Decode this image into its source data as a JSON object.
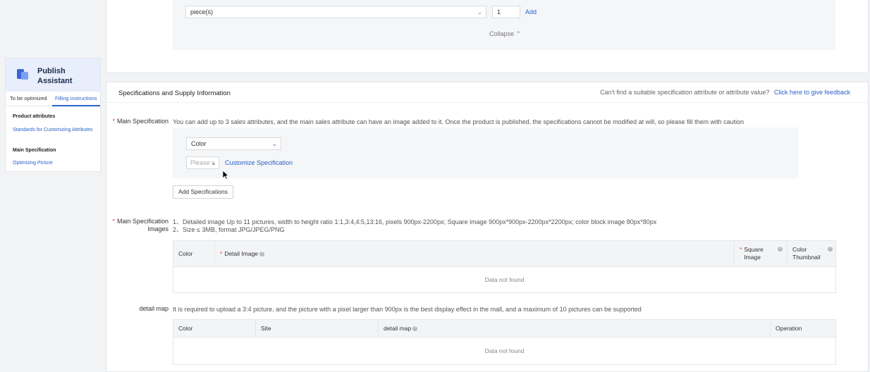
{
  "quantity": {
    "unit": "piece(s)",
    "value": "1",
    "add_label": "Add",
    "collapse_label": "Collapse"
  },
  "assistant": {
    "title": "Publish Assistant",
    "tabs": [
      "To be optimized",
      "Filling instructions"
    ],
    "active_tab": 1,
    "items": [
      {
        "label": "Product attributes",
        "type": "heading"
      },
      {
        "label": "Standards for Customizing Attributes",
        "type": "link"
      },
      {
        "label": "Main Specification",
        "type": "heading"
      },
      {
        "label": "Optimizing Picture",
        "type": "link"
      }
    ]
  },
  "spec": {
    "title": "Specifications and Supply Information",
    "feedback_text": "Can't find a suitable specification attribute or attribute value?",
    "feedback_link": "Click here to give feedback",
    "main_spec": {
      "label": "Main Specification",
      "hint": "You can add up to 3 sales attributes, and the main sales attribute can have an image added to it. Once the product is published, the specifications cannot be modified at will, so please fill them with caution",
      "attribute": "Color",
      "value_placeholder": "Please s",
      "customize_label": "Customize Specification",
      "add_button": "Add Specifications"
    },
    "images": {
      "label": "Main Specification Images",
      "hints": [
        "1、Detailed image Up to 11 pictures, width to height ratio 1:1,3:4,4:5,13:16, pixels 900px-2200px; Square image 900px*900px-2200px*2200px; color block image 80px*80px",
        "2、Size ≤ 3MB, format JPG/JPEG/PNG"
      ],
      "columns": [
        "Color",
        "Detail Image",
        "Square Image",
        "Color Thumbnail"
      ],
      "empty": "Data not found"
    },
    "detail_map": {
      "label": "detail map",
      "hint": "It is required to upload a 3:4 picture, and the picture with a pixel larger than 900px is the best display effect in the mall, and a maximum of 10 pictures can be supported",
      "columns": [
        "Color",
        "Site",
        "detail map",
        "Operation"
      ],
      "empty": "Data not found"
    }
  },
  "colors": {
    "accent": "#2a62c9",
    "required": "#e8453c",
    "assistant_header": "#e8eefb"
  }
}
